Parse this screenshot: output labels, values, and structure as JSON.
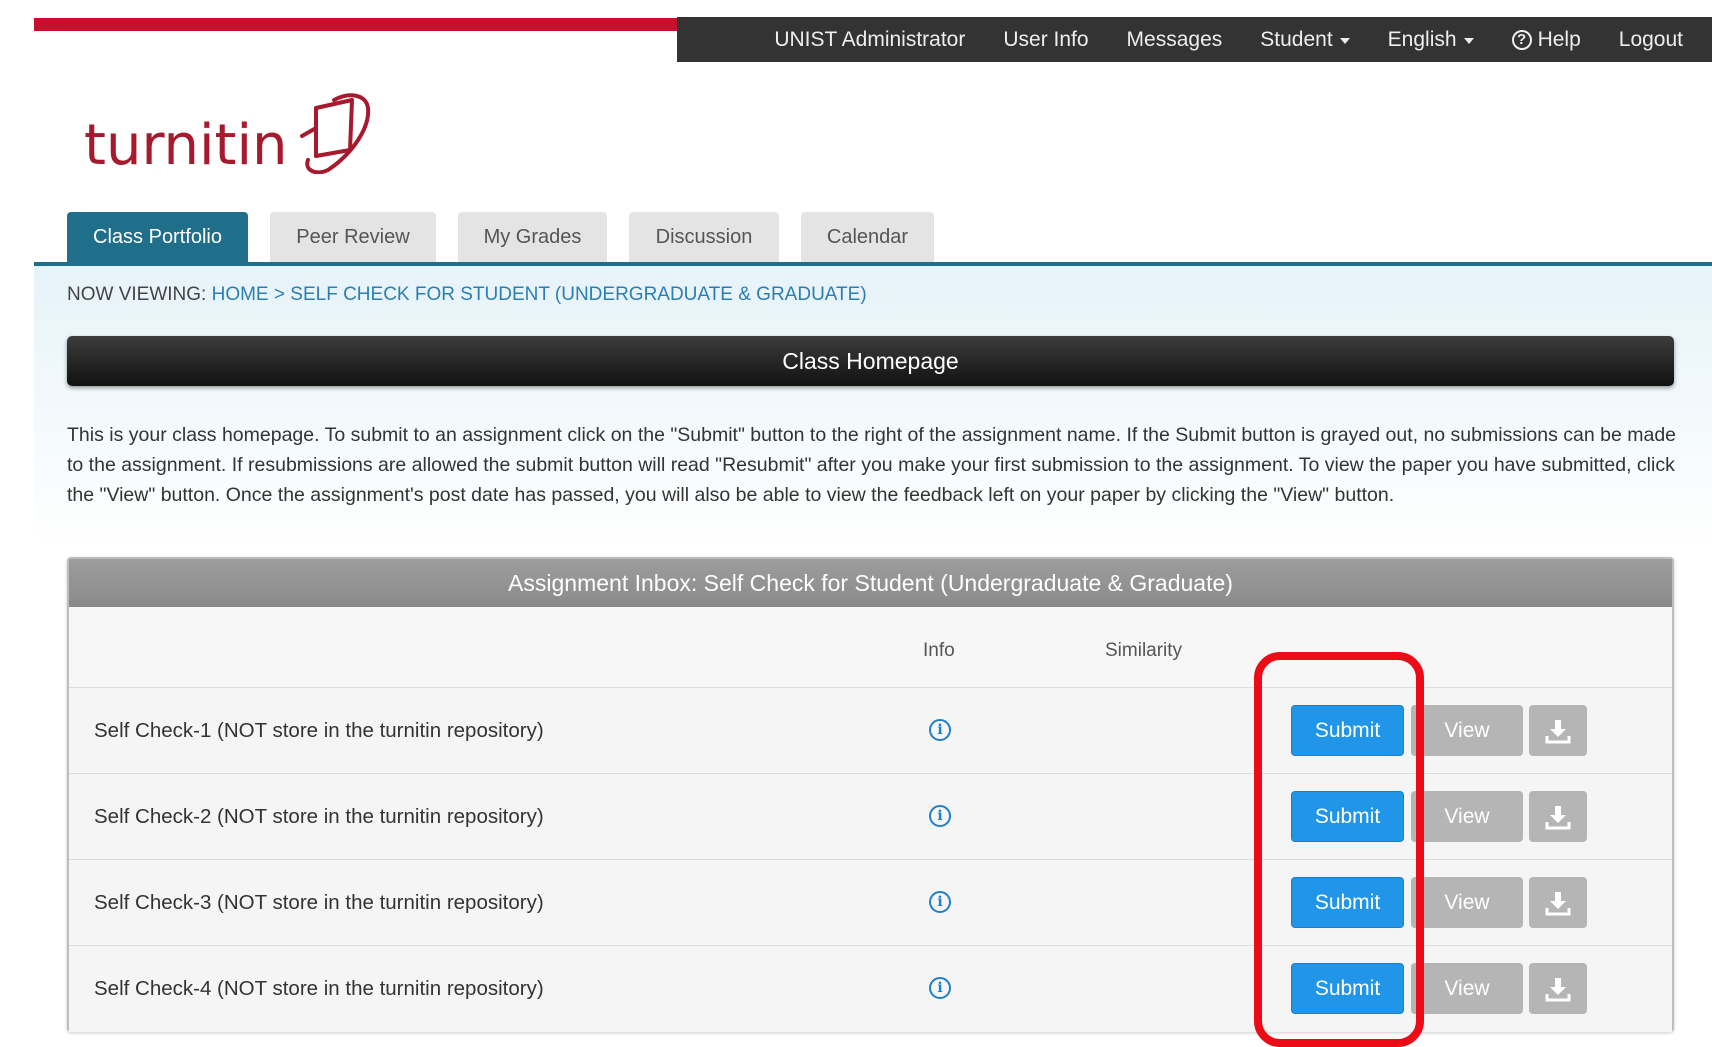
{
  "top_nav": {
    "items": [
      "UNIST Administrator",
      "User Info",
      "Messages",
      "Student",
      "English",
      "Help",
      "Logout"
    ],
    "help_icon": "question-circle-icon"
  },
  "logo": {
    "text": "turnitin"
  },
  "tabs": [
    "Class Portfolio",
    "Peer Review",
    "My Grades",
    "Discussion",
    "Calendar"
  ],
  "breadcrumb": {
    "prefix": "NOW VIEWING:",
    "home": "HOME",
    "separator": ">",
    "current": "SELF CHECK FOR STUDENT (UNDERGRADUATE & GRADUATE)"
  },
  "class_bar": {
    "title": "Class Homepage"
  },
  "intro": "This is your class homepage. To submit to an assignment click on the \"Submit\" button to the right of the assignment name. If the Submit button is grayed out, no submissions can be made to the assignment. If resubmissions are allowed the submit button will read \"Resubmit\" after you make your first submission to the assignment. To view the paper you have submitted, click the \"View\" button. Once the assignment's post date has passed, you will also be able to view the feedback left on your paper by clicking the \"View\" button.",
  "inbox": {
    "title": "Assignment Inbox: Self Check for Student (Undergraduate & Graduate)",
    "columns": {
      "info": "Info",
      "similarity": "Similarity"
    },
    "rows": [
      {
        "title": "Self Check-1 (NOT store in the turnitin repository)",
        "submit": "Submit",
        "view": "View"
      },
      {
        "title": "Self Check-2 (NOT store in the turnitin repository)",
        "submit": "Submit",
        "view": "View"
      },
      {
        "title": "Self Check-3 (NOT store in the turnitin repository)",
        "submit": "Submit",
        "view": "View"
      },
      {
        "title": "Self Check-4 (NOT store in the turnitin repository)",
        "submit": "Submit",
        "view": "View"
      }
    ]
  },
  "colors": {
    "brand_red": "#a7192c",
    "tab_active": "#1f6f8b",
    "submit_blue": "#2196e8",
    "highlight_red": "#ec0b17"
  }
}
